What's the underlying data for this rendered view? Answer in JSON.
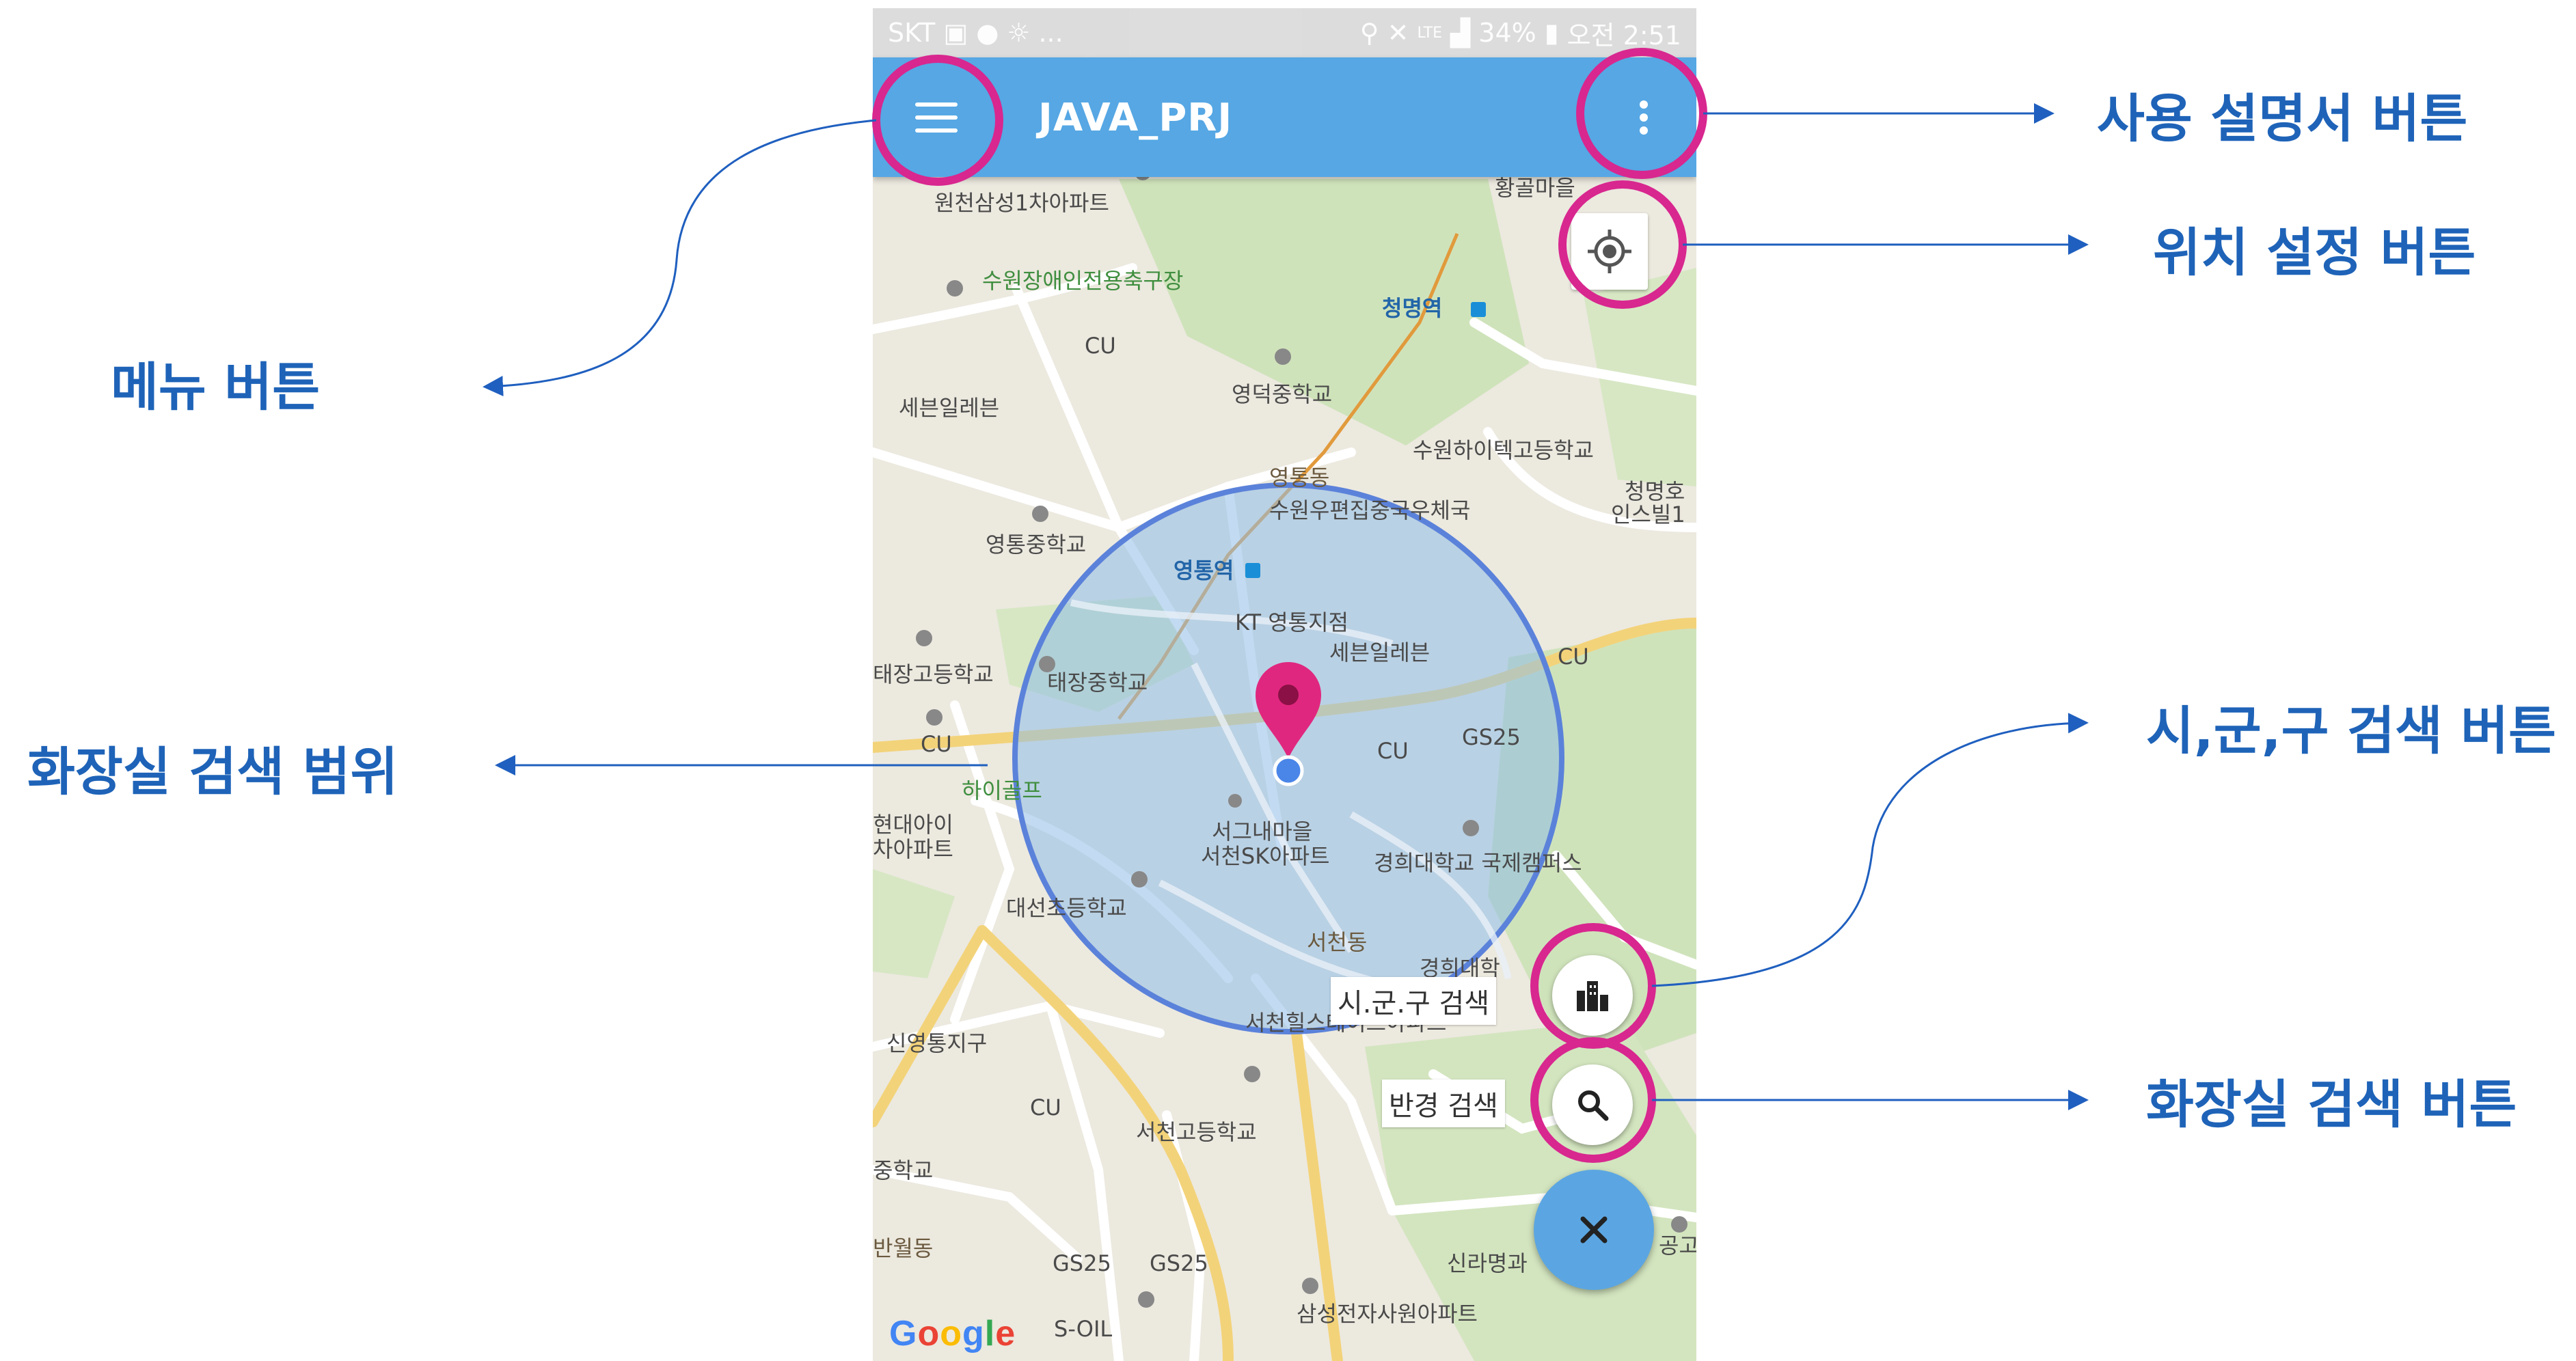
{
  "status_bar": {
    "carrier": "SKT",
    "extra": "...",
    "network": "LTE",
    "battery": "34%",
    "time": "오전 2:51"
  },
  "app_bar": {
    "title": "JAVA_PRJ"
  },
  "map": {
    "labels": [
      {
        "text": "원천삼성1차아파트",
        "style": "normal"
      },
      {
        "text": "황골마을",
        "style": "normal"
      },
      {
        "text": "수원장애인전용축구장",
        "style": "green"
      },
      {
        "text": "CU",
        "style": "normal"
      },
      {
        "text": "청명역",
        "style": "blue"
      },
      {
        "text": "세븐일레븐",
        "style": "normal"
      },
      {
        "text": "영덕중학교",
        "style": "normal"
      },
      {
        "text": "수원하이텍고등학교",
        "style": "normal"
      },
      {
        "text": "영통동",
        "style": "brown"
      },
      {
        "text": "청명호",
        "style": "normal"
      },
      {
        "text": "인스빌1",
        "style": "normal"
      },
      {
        "text": "수원우편집중국우체국",
        "style": "normal"
      },
      {
        "text": "영통중학교",
        "style": "normal"
      },
      {
        "text": "영통역",
        "style": "blue"
      },
      {
        "text": "KT 영통지점",
        "style": "normal"
      },
      {
        "text": "태장고등학교",
        "style": "normal"
      },
      {
        "text": "태장중학교",
        "style": "normal"
      },
      {
        "text": "세븐일레븐",
        "style": "normal"
      },
      {
        "text": "CU",
        "style": "normal"
      },
      {
        "text": "CU",
        "style": "normal"
      },
      {
        "text": "CU",
        "style": "normal"
      },
      {
        "text": "GS25",
        "style": "normal"
      },
      {
        "text": "하이골프",
        "style": "green"
      },
      {
        "text": "현대아이",
        "style": "normal"
      },
      {
        "text": "차아파트",
        "style": "normal"
      },
      {
        "text": "서그내마을",
        "style": "normal"
      },
      {
        "text": "서천SK아파트",
        "style": "normal"
      },
      {
        "text": "경희대학교 국제캠퍼스",
        "style": "normal"
      },
      {
        "text": "대선초등학교",
        "style": "normal"
      },
      {
        "text": "서천동",
        "style": "brown"
      },
      {
        "text": "경희대학",
        "style": "normal"
      },
      {
        "text": "신영통지구",
        "style": "normal"
      },
      {
        "text": "서천힐스테이트아파트",
        "style": "normal"
      },
      {
        "text": "CU",
        "style": "normal"
      },
      {
        "text": "서천고등학교",
        "style": "normal"
      },
      {
        "text": "중학교",
        "style": "normal"
      },
      {
        "text": "반월동",
        "style": "brown"
      },
      {
        "text": "GS25",
        "style": "normal"
      },
      {
        "text": "GS25",
        "style": "normal"
      },
      {
        "text": "신라명과",
        "style": "normal"
      },
      {
        "text": "S-OIL",
        "style": "normal"
      },
      {
        "text": "삼성전자사원아파트",
        "style": "normal"
      },
      {
        "text": "공고",
        "style": "normal"
      }
    ]
  },
  "fabs": {
    "region_label": "시.군.구 검색",
    "radius_label": "반경 검색"
  },
  "google_logo": "Google",
  "colors": {
    "app_bar": "#56a7e4",
    "highlight_ring": "#d8278f",
    "annotation_text": "#1e63b8",
    "search_range_fill": "#8fbde8",
    "pin": "#e0277f",
    "fab_main": "#5ba6e2"
  },
  "icons": {
    "menu": "hamburger-icon",
    "more": "more-vert-icon",
    "location": "crosshair-icon",
    "region": "city-icon",
    "search": "search-icon",
    "close": "close-icon"
  },
  "annotations": {
    "menu": "메뉴 버튼",
    "manual": "사용 설명서 버튼",
    "location": "위치 설정 버튼",
    "range": "화장실 검색 범위",
    "region": "시,군,구 검색 버튼",
    "toilet_search": "화장실 검색 버튼"
  }
}
